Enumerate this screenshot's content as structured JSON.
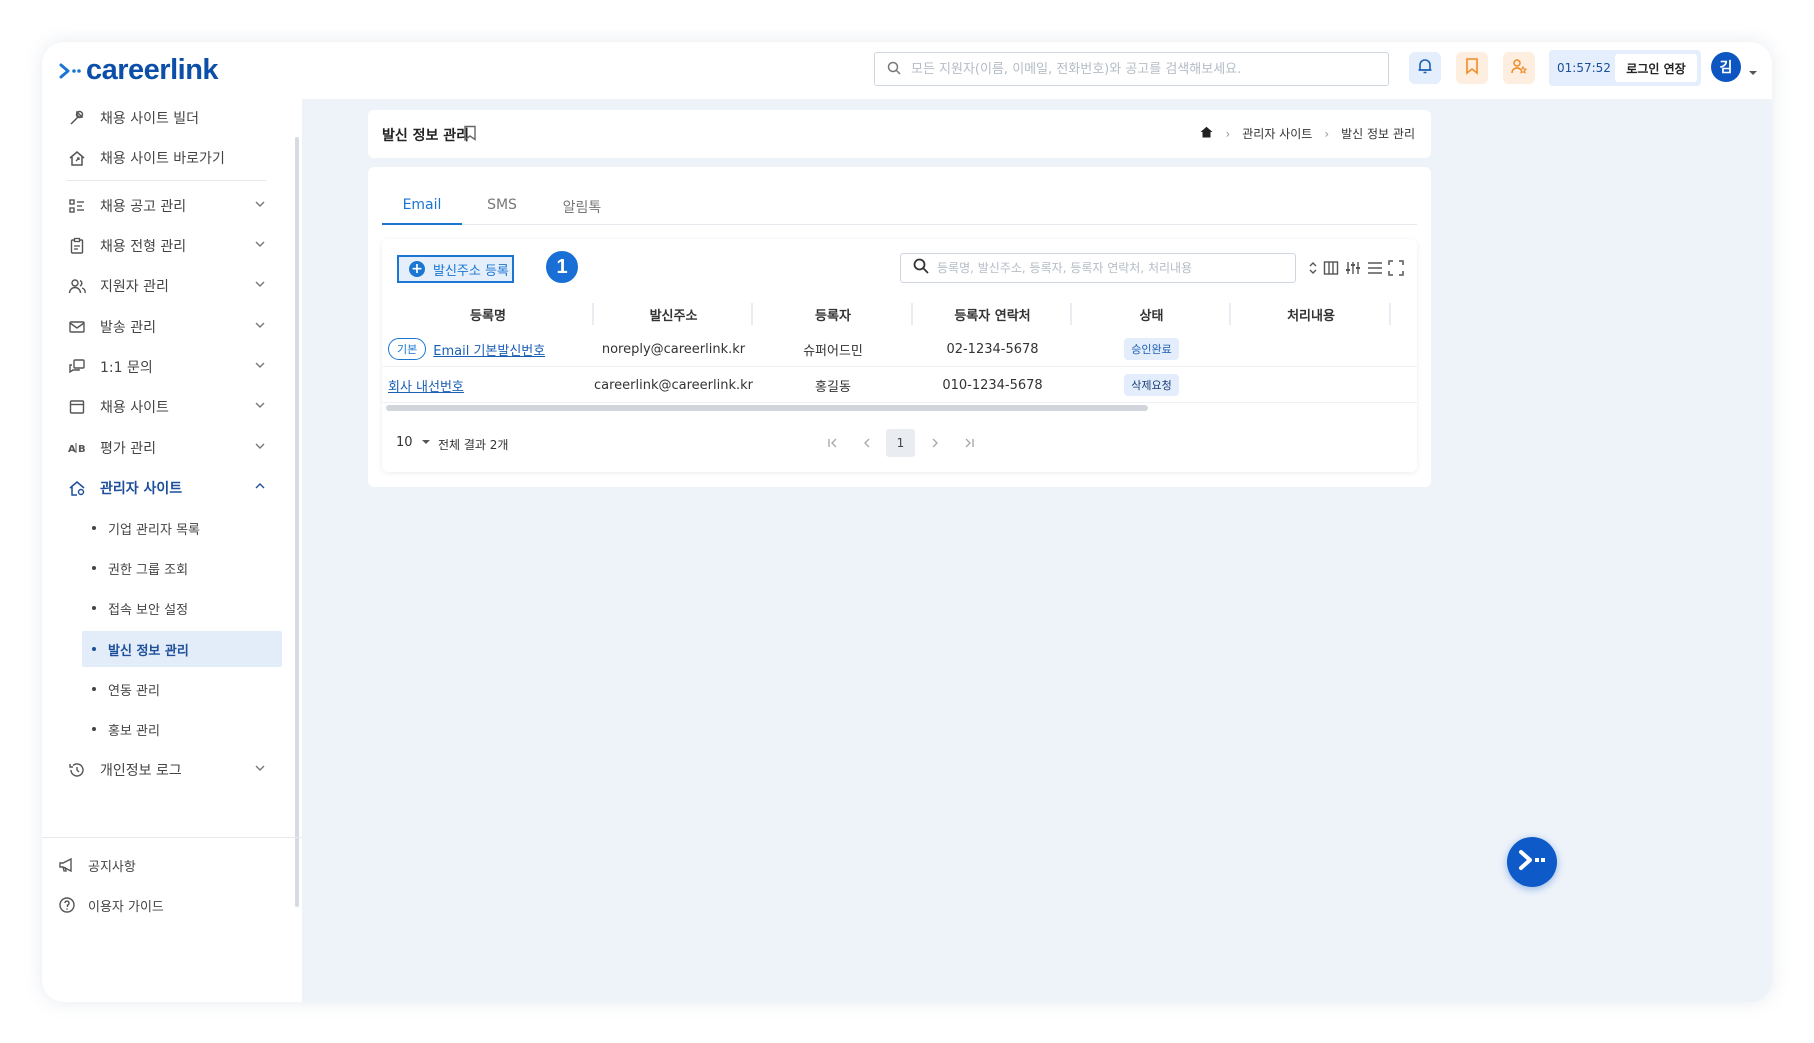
{
  "brand": {
    "name": "careerlink",
    "color": "#0b4fa8",
    "accent": "#1a76d2"
  },
  "header": {
    "search_placeholder": "모든 지원자(이름, 이메일, 전화번호)와 공고를 검색해보세요.",
    "timer": "01:57:52",
    "extend_label": "로그인 연장",
    "avatar_initial": "김"
  },
  "sidebar": {
    "top_items": [
      {
        "label": "채용 사이트 빌더",
        "icon": "builder-icon"
      },
      {
        "label": "채용 사이트 바로가기",
        "icon": "home-link-icon"
      }
    ],
    "items": [
      {
        "label": "채용 공고 관리",
        "icon": "list-icon"
      },
      {
        "label": "채용 전형 관리",
        "icon": "clipboard-icon"
      },
      {
        "label": "지원자 관리",
        "icon": "users-icon"
      },
      {
        "label": "발송 관리",
        "icon": "mail-icon"
      },
      {
        "label": "1:1 문의",
        "icon": "chat-icon"
      },
      {
        "label": "채용 사이트",
        "icon": "window-icon"
      },
      {
        "label": "평가 관리",
        "icon": "ab-icon"
      },
      {
        "label": "관리자 사이트",
        "icon": "admin-home-icon"
      }
    ],
    "admin_sub": [
      "기업 관리자 목록",
      "권한 그룹 조회",
      "접속 보안 설정",
      "발신 정보 관리",
      "연동 관리",
      "홍보 관리"
    ],
    "privacy_log": "개인정보 로그",
    "bottom": [
      {
        "label": "공지사항",
        "icon": "megaphone-icon"
      },
      {
        "label": "이용자 가이드",
        "icon": "help-icon"
      }
    ]
  },
  "page": {
    "title": "발신 정보 관리",
    "breadcrumb": [
      "관리자 사이트",
      "발신 정보 관리"
    ]
  },
  "tabs": [
    "Email",
    "SMS",
    "알림톡"
  ],
  "toolbar": {
    "add_label": "발신주소 등록",
    "step_number": "1",
    "search_placeholder": "등록명, 발신주소, 등록자, 등록자 연락처, 처리내용"
  },
  "table": {
    "columns": [
      "등록명",
      "발신주소",
      "등록자",
      "등록자 연락처",
      "상태",
      "처리내용"
    ],
    "rows": [
      {
        "chip": "기본",
        "name": "Email 기본발신번호",
        "address": "noreply@careerlink.kr",
        "registrant": "슈퍼어드민",
        "phone": "02-1234-5678",
        "status": "승인완료",
        "note": ""
      },
      {
        "chip": "",
        "name": "회사 내선번호",
        "address": "careerlink@careerlink.kr",
        "registrant": "홍길동",
        "phone": "010-1234-5678",
        "status": "삭제요청",
        "note": ""
      }
    ]
  },
  "footer": {
    "page_size": "10",
    "total_label": "전체 결과 2개",
    "current_page": "1"
  }
}
